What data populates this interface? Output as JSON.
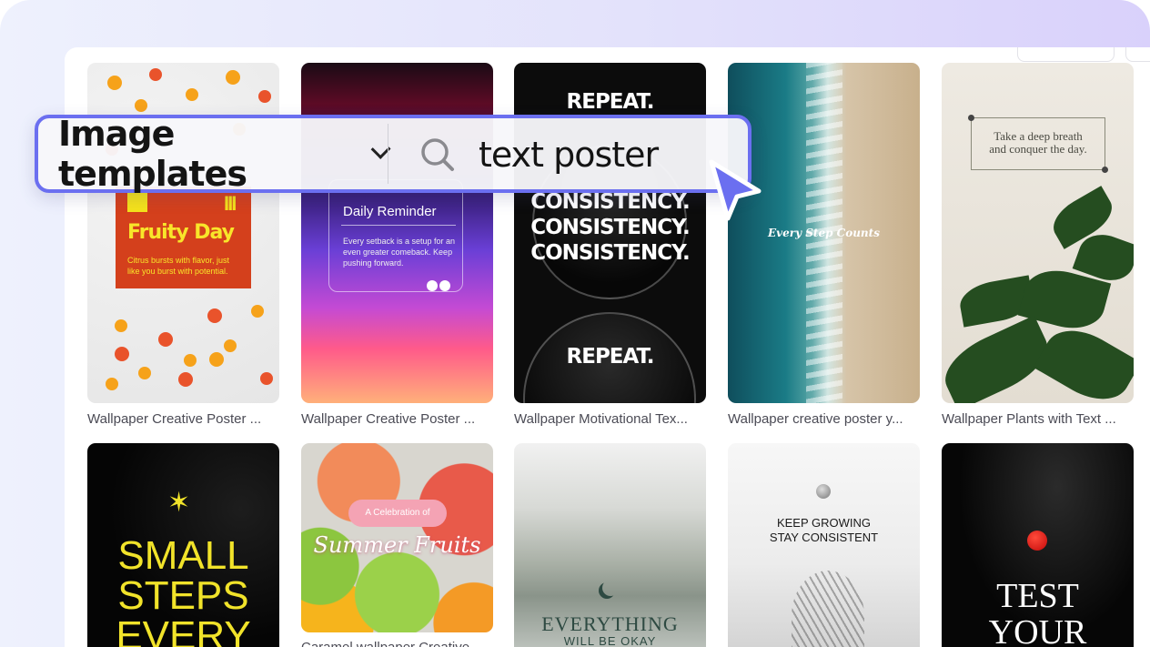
{
  "search": {
    "filter_label": "Image templates",
    "query": "text poster"
  },
  "cards": [
    {
      "caption": "Wallpaper Creative Poster ...",
      "title": "Fruity Day",
      "subtitle": "Citrus bursts with flavor, just like you burst with potential."
    },
    {
      "caption": "Wallpaper Creative Poster ...",
      "title": "Daily Reminder",
      "subtitle": "Every setback is a setup for an even greater comeback. Keep pushing forward."
    },
    {
      "caption": "Wallpaper Motivational Tex...",
      "line_repeat": "REPEAT.",
      "line_consistency": "CONSISTENCY."
    },
    {
      "caption": "Wallpaper creative poster y...",
      "title": "Every Step Counts"
    },
    {
      "caption": "Wallpaper Plants with Text ...",
      "title_line1": "Take a deep breath",
      "title_line2": "and conquer the day."
    },
    {
      "line1": "SMALL",
      "line2": "STEPS",
      "line3": "EVERY"
    },
    {
      "caption": "Caramel wallpaper Creative ...",
      "pill": "A Celebration of",
      "title": "Summer Fruits"
    },
    {
      "title": "EVERYTHING",
      "subtitle": "WILL BE OKAY"
    },
    {
      "line1": "KEEP GROWING",
      "line2": "STAY CONSISTENT"
    },
    {
      "line1": "TEST",
      "line2": "YOUR"
    }
  ],
  "colors": {
    "accent": "#6b6ff0",
    "fruity_orange": "#d4401c",
    "fruity_yellow": "#f4e21b",
    "small_steps_yellow": "#f1e32a"
  }
}
